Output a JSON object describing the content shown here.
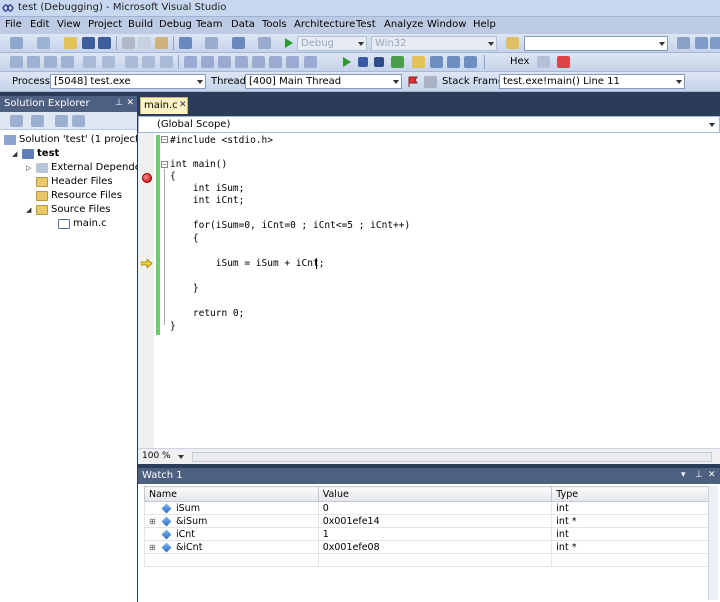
{
  "titlebar": {
    "title": "test (Debugging) - Microsoft Visual Studio"
  },
  "menu": [
    "File",
    "Edit",
    "View",
    "Project",
    "Build",
    "Debug",
    "Team",
    "Data",
    "Tools",
    "Architecture",
    "Test",
    "Analyze",
    "Window",
    "Help"
  ],
  "toolbar1": {
    "config": "Debug",
    "platform": "Win32",
    "find_value": ""
  },
  "toolbar2": {
    "hex_label": "Hex"
  },
  "toolbar3": {
    "process_label": "Process:",
    "process_value": "[5048] test.exe",
    "thread_label": "Thread:",
    "thread_value": "[400] Main Thread",
    "stackframe_label": "Stack Frame:",
    "stackframe_value": "test.exe!main()  Line 11"
  },
  "solution_explorer": {
    "title": "Solution Explorer",
    "items": [
      {
        "label": "Solution 'test' (1 project)"
      },
      {
        "label": "test"
      },
      {
        "label": "External Dependencies"
      },
      {
        "label": "Header Files"
      },
      {
        "label": "Resource Files"
      },
      {
        "label": "Source Files"
      },
      {
        "label": "main.c"
      }
    ]
  },
  "editor": {
    "tab_label": "main.c",
    "scope": "(Global Scope)",
    "zoom": "100 %",
    "lines": [
      "#include <stdio.h>",
      "",
      "int main()",
      "{",
      "    int iSum;",
      "    int iCnt;",
      "",
      "    for(iSum=0, iCnt=0 ; iCnt<=5 ; iCnt++)",
      "    {",
      "",
      "        iSum = iSum + iCnt;",
      "",
      "    }",
      "",
      "    return 0;",
      "}"
    ]
  },
  "watch": {
    "title": "Watch 1",
    "columns": [
      "Name",
      "Value",
      "Type"
    ],
    "rows": [
      {
        "expandable": false,
        "name": "iSum",
        "value": "0",
        "type": "int"
      },
      {
        "expandable": true,
        "name": "&iSum",
        "value": "0x001efe14",
        "type": "int *"
      },
      {
        "expandable": false,
        "name": "iCnt",
        "value": "1",
        "type": "int"
      },
      {
        "expandable": true,
        "name": "&iCnt",
        "value": "0x001efe08",
        "type": "int *"
      }
    ]
  }
}
